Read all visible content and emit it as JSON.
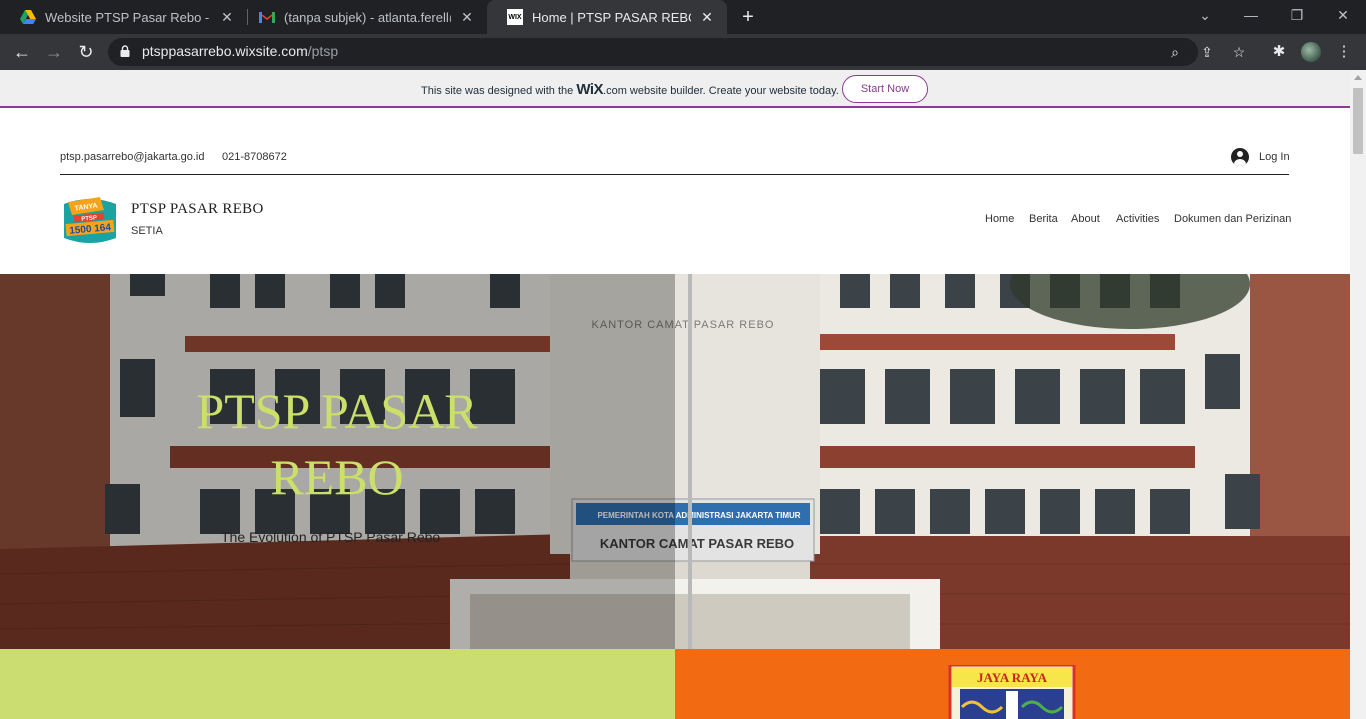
{
  "browser": {
    "tabs": [
      {
        "title": "Website PTSP Pasar Rebo - Goog",
        "favicon": "google-drive-icon"
      },
      {
        "title": "(tanpa subjek) - atlanta.ferell@gm",
        "favicon": "gmail-icon"
      },
      {
        "title": "Home | PTSP PASAR REBO",
        "favicon": "wix-icon",
        "favicon_text": "WIX",
        "active": true
      }
    ],
    "url_host": "ptsppasarrebo.wixsite.com",
    "url_path": "/ptsp"
  },
  "wix_banner": {
    "text_before": "This site was designed with the ",
    "logo": "WiX",
    "text_after": ".com website builder. Create your website today.",
    "button": "Start Now"
  },
  "header": {
    "email": "ptsp.pasarrebo@jakarta.go.id",
    "phone": "021-8708672",
    "login": "Log In",
    "site_name": "PTSP PASAR REBO",
    "tagline": "SETIA",
    "nav": [
      "Home",
      "Berita",
      "About",
      "Activities",
      "Dokumen dan Perizinan"
    ]
  },
  "hero": {
    "title": "PTSP PASAR REBO",
    "subtitle": "The Evolution of PTSP Pasar Rebo",
    "building_sign": "KANTOR CAMAT PASAR REBO",
    "board_line1": "PEMERINTAH KOTA ADMINISTRASI JAKARTA TIMUR",
    "board_line2": "KANTOR CAMAT PASAR REBO"
  },
  "emblem_text": "JAYA RAYA",
  "colors": {
    "green_block": "#cbdc70",
    "orange_block": "#f26b12",
    "wix_accent": "#8a3b92",
    "hero_title": "#cbe06a"
  }
}
